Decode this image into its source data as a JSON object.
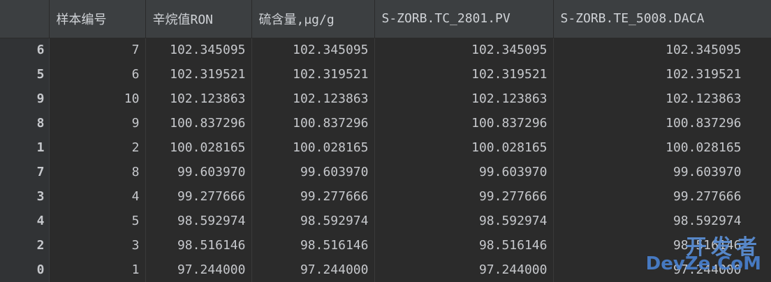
{
  "table": {
    "columns": [
      {
        "label": ""
      },
      {
        "label": "样本编号"
      },
      {
        "label": "辛烷值RON"
      },
      {
        "label": "硫含量,μg/g"
      },
      {
        "label": "S-ZORB.TC_2801.PV"
      },
      {
        "label": "S-ZORB.TE_5008.DACA"
      }
    ],
    "rows": [
      {
        "index": "6",
        "sample": "7",
        "ron": "102.345095",
        "sulfur": "102.345095",
        "tc2801": "102.345095",
        "te5008": "102.345095"
      },
      {
        "index": "5",
        "sample": "6",
        "ron": "102.319521",
        "sulfur": "102.319521",
        "tc2801": "102.319521",
        "te5008": "102.319521"
      },
      {
        "index": "9",
        "sample": "10",
        "ron": "102.123863",
        "sulfur": "102.123863",
        "tc2801": "102.123863",
        "te5008": "102.123863"
      },
      {
        "index": "8",
        "sample": "9",
        "ron": "100.837296",
        "sulfur": "100.837296",
        "tc2801": "100.837296",
        "te5008": "100.837296"
      },
      {
        "index": "1",
        "sample": "2",
        "ron": "100.028165",
        "sulfur": "100.028165",
        "tc2801": "100.028165",
        "te5008": "100.028165"
      },
      {
        "index": "7",
        "sample": "8",
        "ron": "99.603970",
        "sulfur": "99.603970",
        "tc2801": "99.603970",
        "te5008": "99.603970"
      },
      {
        "index": "3",
        "sample": "4",
        "ron": "99.277666",
        "sulfur": "99.277666",
        "tc2801": "99.277666",
        "te5008": "99.277666"
      },
      {
        "index": "4",
        "sample": "5",
        "ron": "98.592974",
        "sulfur": "98.592974",
        "tc2801": "98.592974",
        "te5008": "98.592974"
      },
      {
        "index": "2",
        "sample": "3",
        "ron": "98.516146",
        "sulfur": "98.516146",
        "tc2801": "98.516146",
        "te5008": "98.516146"
      },
      {
        "index": "0",
        "sample": "1",
        "ron": "97.244000",
        "sulfur": "97.244000",
        "tc2801": "97.244000",
        "te5008": "97.244000"
      }
    ]
  },
  "watermark": {
    "line1": "开发者",
    "line2": "DevZe.CoM"
  }
}
